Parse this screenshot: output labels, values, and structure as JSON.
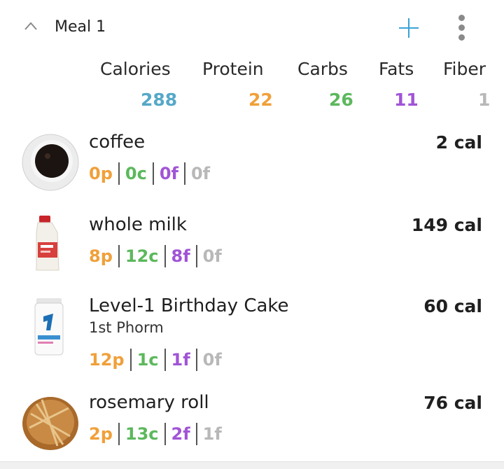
{
  "meal": {
    "title": "Meal 1"
  },
  "colors": {
    "accent": "#3ba3d6",
    "protein": "#f0a03a",
    "carbs": "#5cb85c",
    "fats": "#a154d6",
    "fiber": "#b8b8b8",
    "calories": "#56a8c8"
  },
  "icons": {
    "collapse": "chevron-up-icon",
    "add": "plus-icon",
    "more": "kebab-menu-icon"
  },
  "headers": {
    "calories": "Calories",
    "protein": "Protein",
    "carbs": "Carbs",
    "fats": "Fats",
    "fiber": "Fiber"
  },
  "totals": {
    "calories": "288",
    "protein": "22",
    "carbs": "26",
    "fats": "11",
    "fiber": "1"
  },
  "foods": [
    {
      "name": "coffee",
      "brand": "",
      "cal": "2 cal",
      "p": "0p",
      "c": "0c",
      "f": "0f",
      "fiber": "0f"
    },
    {
      "name": "whole milk",
      "brand": "",
      "cal": "149 cal",
      "p": "8p",
      "c": "12c",
      "f": "8f",
      "fiber": "0f"
    },
    {
      "name": "Level-1 Birthday Cake",
      "brand": "1st Phorm",
      "cal": "60 cal",
      "p": "12p",
      "c": "1c",
      "f": "1f",
      "fiber": "0f"
    },
    {
      "name": "rosemary roll",
      "brand": "",
      "cal": "76 cal",
      "p": "2p",
      "c": "13c",
      "f": "2f",
      "fiber": "1f"
    }
  ]
}
